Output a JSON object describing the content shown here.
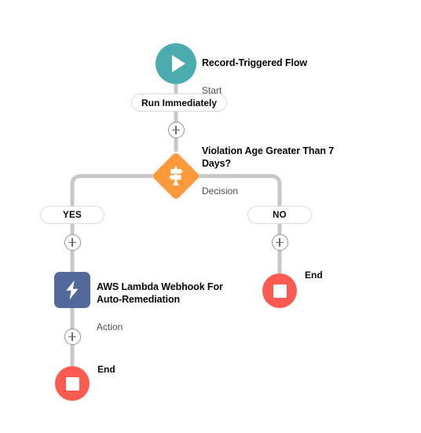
{
  "canvas": {
    "background": "#ffffff",
    "connector_color": "#c9c7c5"
  },
  "flow": {
    "start": {
      "title": "Record-Triggered Flow",
      "subtitle": "Start",
      "icon": "play-icon",
      "color": "#4BACB0"
    },
    "trigger_pill": {
      "label": "Run Immediately"
    },
    "decision": {
      "title": "Violation Age Greater Than 7 Days?",
      "subtitle": "Decision",
      "icon": "signpost-icon",
      "color": "#FF9A3C"
    },
    "branches": [
      {
        "label": "YES",
        "name": "yes-branch"
      },
      {
        "label": "NO",
        "name": "no-branch"
      }
    ],
    "action": {
      "title": "AWS Lambda Webhook For Auto-Remediation",
      "subtitle": "Action",
      "icon": "lightning-bolt-icon",
      "color": "#54699B"
    },
    "ends": [
      {
        "label": "End",
        "name": "end-node-no-branch",
        "icon": "stop-icon",
        "color": "#FB5B50"
      },
      {
        "label": "End",
        "name": "end-node-yes-branch",
        "icon": "stop-icon",
        "color": "#FB5B50"
      }
    ],
    "add_buttons": [
      {
        "name": "add-element-after-trigger"
      },
      {
        "name": "add-element-yes-branch"
      },
      {
        "name": "add-element-no-branch"
      },
      {
        "name": "add-element-after-action"
      }
    ]
  }
}
